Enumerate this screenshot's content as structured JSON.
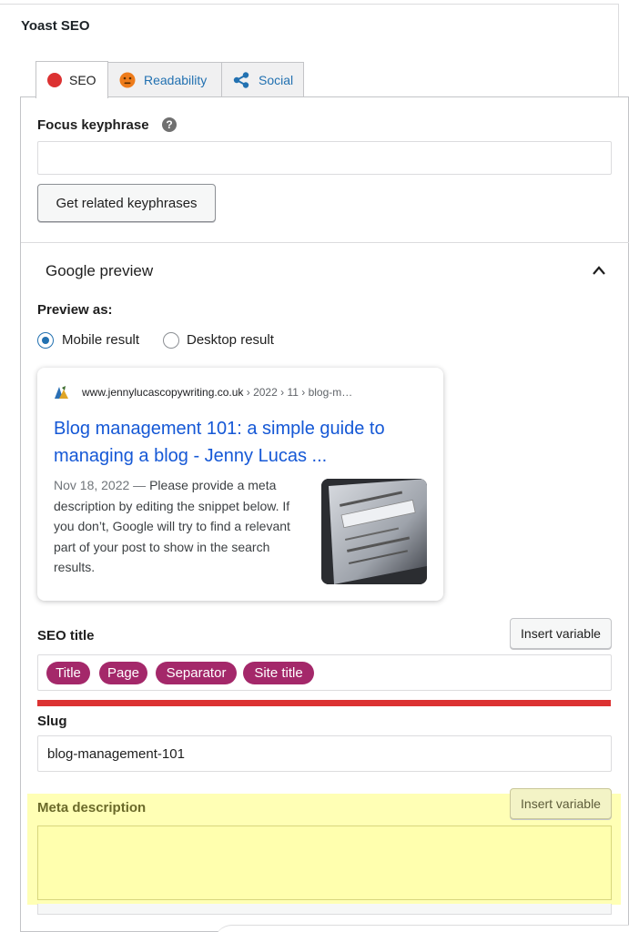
{
  "metabox": {
    "title": "Yoast SEO"
  },
  "tabs": [
    {
      "label": "SEO",
      "icon": "red-dot-icon",
      "active": true
    },
    {
      "label": "Readability",
      "icon": "neutral-face-icon",
      "active": false
    },
    {
      "label": "Social",
      "icon": "share-icon",
      "active": false
    }
  ],
  "focus": {
    "label": "Focus keyphrase",
    "help": "?",
    "value": "",
    "related_button": "Get related keyphrases"
  },
  "google_preview": {
    "title": "Google preview",
    "preview_as_label": "Preview as:",
    "options": [
      {
        "label": "Mobile result",
        "checked": true
      },
      {
        "label": "Desktop result",
        "checked": false
      }
    ],
    "card": {
      "domain": "www.jennylucascopywriting.co.uk",
      "breadcrumb": " › 2022 › 11 › blog-m…",
      "title": "Blog management 101: a simple guide to managing a blog - Jenny Lucas ...",
      "date": "Nov 18, 2022",
      "date_sep": " — ",
      "description": "Please provide a meta description by editing the snippet below. If you don’t, Google will try to find a relevant part of your post to show in the search results."
    }
  },
  "seo_title": {
    "label": "SEO title",
    "insert_variable": "Insert variable",
    "pills": [
      "Title",
      "Page",
      "Separator",
      "Site title"
    ],
    "progress_color": "#dc3232"
  },
  "slug": {
    "label": "Slug",
    "value": "blog-management-101"
  },
  "meta_description": {
    "label": "Meta description",
    "insert_variable": "Insert variable",
    "value": ""
  },
  "colors": {
    "accent": "#2271b1",
    "pill": "#a4286a",
    "link": "#1558d6",
    "error": "#dc3232",
    "highlight": "#ffff78"
  }
}
